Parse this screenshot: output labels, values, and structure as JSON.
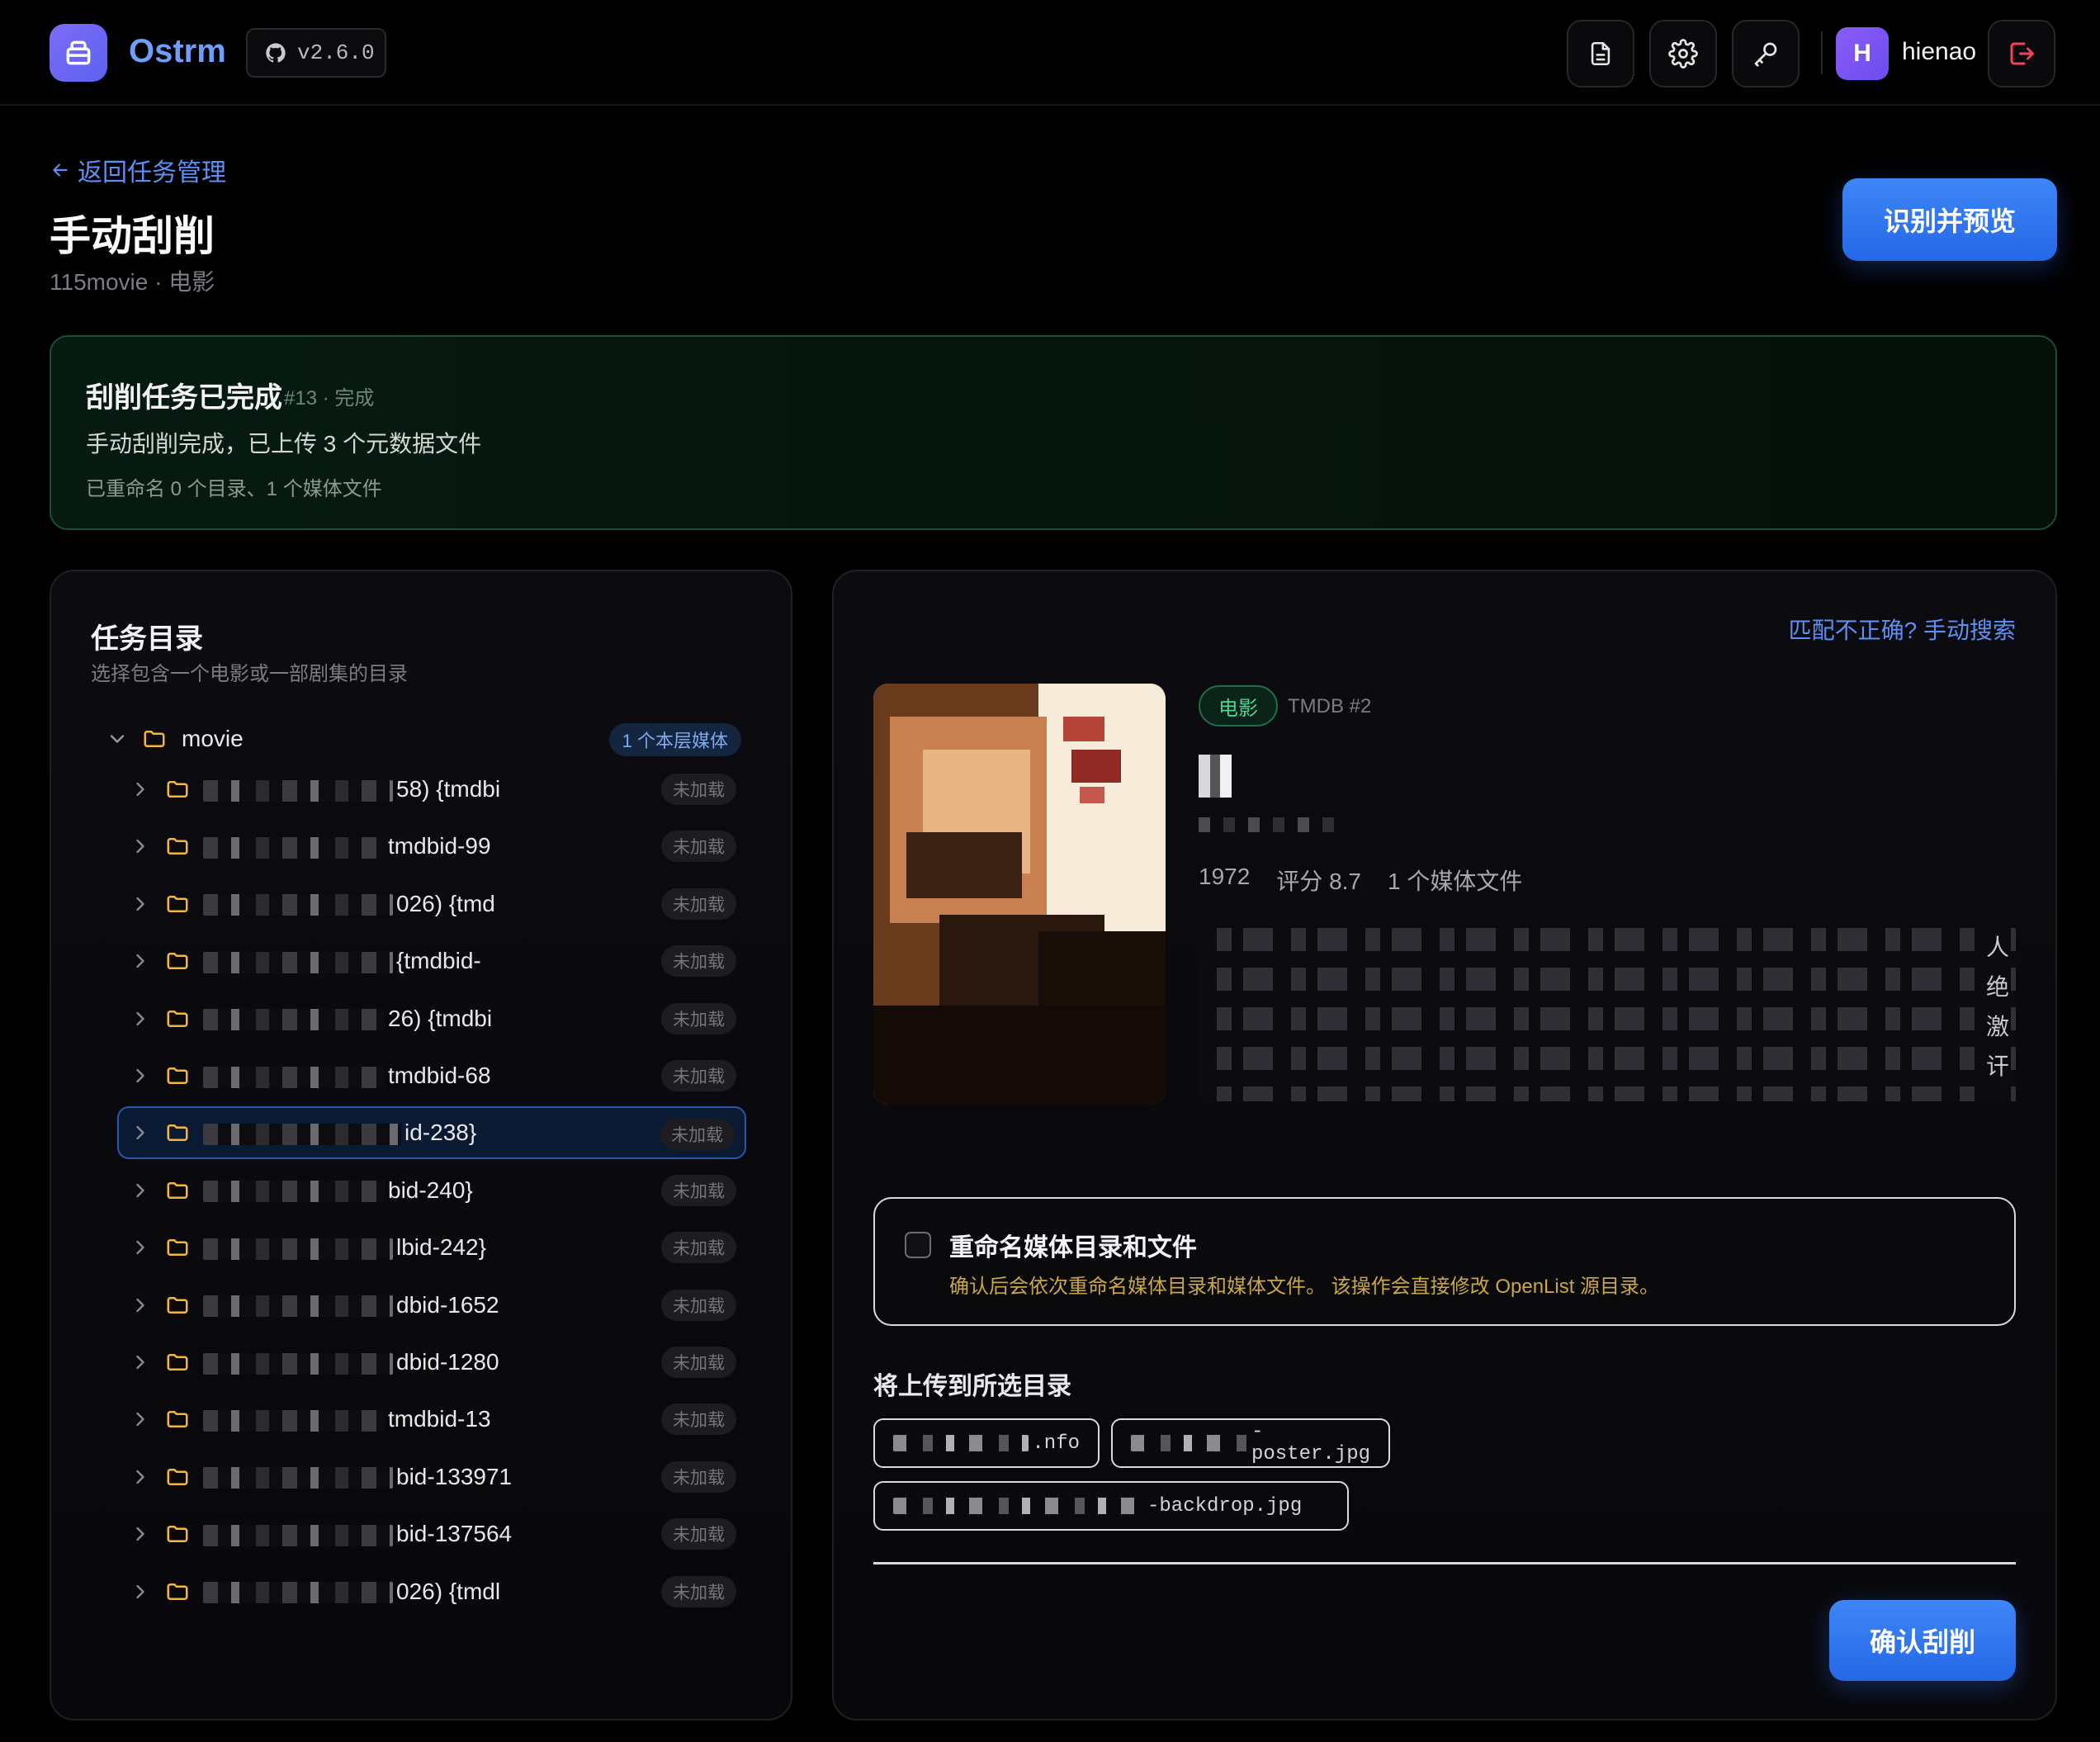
{
  "header": {
    "brand": "Ostrm",
    "version": "v2.6.0",
    "user_initial": "H",
    "username": "hienao"
  },
  "page": {
    "back_label": "返回任务管理",
    "title": "手动刮削",
    "subtitle": "115movie · 电影",
    "preview_button": "识别并预览"
  },
  "banner": {
    "title": "刮削任务已完成",
    "meta": "#13 · 完成",
    "message": "手动刮削完成，已上传 3 个元数据文件",
    "detail": "已重命名 0 个目录、1 个媒体文件"
  },
  "directory": {
    "title": "任务目录",
    "subtitle": "选择包含一个电影或一部剧集的目录",
    "root_name": "movie",
    "root_badge": "1 个本层媒体",
    "items": [
      {
        "visible_text": "58) {tmdbi",
        "badge": "未加载"
      },
      {
        "visible_text": "tmdbid-99",
        "badge": "未加载"
      },
      {
        "visible_text": "026) {tmd",
        "badge": "未加载"
      },
      {
        "visible_text": "{tmdbid-",
        "badge": "未加载"
      },
      {
        "visible_text": "26) {tmdbi",
        "badge": "未加载"
      },
      {
        "visible_text": "tmdbid-68",
        "badge": "未加载"
      },
      {
        "visible_text": "id-238}",
        "badge": "未加载"
      },
      {
        "visible_text": "bid-240}",
        "badge": "未加载"
      },
      {
        "visible_text": "lbid-242}",
        "badge": "未加载"
      },
      {
        "visible_text": "dbid-1652",
        "badge": "未加载"
      },
      {
        "visible_text": "dbid-1280",
        "badge": "未加载"
      },
      {
        "visible_text": "tmdbid-13",
        "badge": "未加载"
      },
      {
        "visible_text": "bid-133971",
        "badge": "未加载"
      },
      {
        "visible_text": "bid-137564",
        "badge": "未加载"
      },
      {
        "visible_text": "026) {tmdl",
        "badge": "未加载"
      }
    ],
    "selected_index": 6
  },
  "detail": {
    "manual_search": "匹配不正确? 手动搜索",
    "type_badge": "电影",
    "tmdb_id": "TMDB #2",
    "year": "1972",
    "rating": "评分 8.7",
    "media_count": "1 个媒体文件",
    "overview_visible_chars": "人 绝 激 讦 .."
  },
  "rename": {
    "title": "重命名媒体目录和文件",
    "description": "确认后会依次重命名媒体目录和媒体文件。 该操作会直接修改 OpenList 源目录。",
    "checked": false
  },
  "upload": {
    "label": "将上传到所选目录",
    "files": [
      ".nfo",
      "-poster.jpg",
      "-backdrop.jpg"
    ]
  },
  "confirm_button": "确认刮削",
  "colors": {
    "accent_blue": "#2f78f0",
    "link_blue": "#5d8ff5",
    "success_green": "#4fd392",
    "warning_gold": "#c9a64a"
  }
}
